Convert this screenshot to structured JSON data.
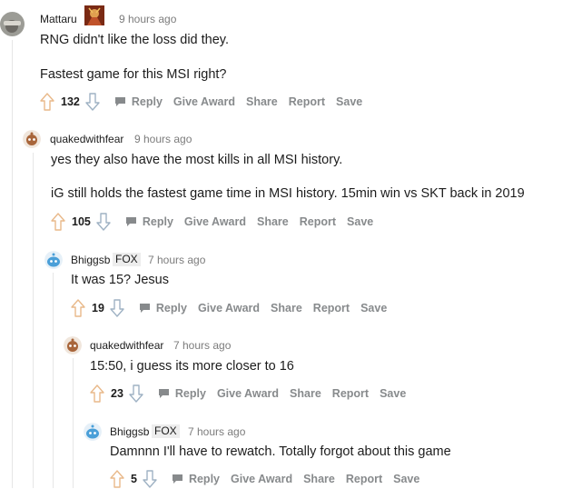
{
  "comments": [
    {
      "user": "Mattaru",
      "time": "9 hours ago",
      "lines": [
        "RNG didn't like the loss did they.",
        "Fastest game for this MSI right?"
      ],
      "votes": "132"
    },
    {
      "user": "quakedwithfear",
      "time": "9 hours ago",
      "lines": [
        "yes they also have the most kills in all MSI history.",
        "iG still holds the fastest game time in MSI history. 15min win vs SKT back in 2019"
      ],
      "votes": "105"
    },
    {
      "user": "Bhiggsb",
      "flair": "FOX",
      "time": "7 hours ago",
      "lines": [
        "It was 15? Jesus"
      ],
      "votes": "19"
    },
    {
      "user": "quakedwithfear",
      "time": "7 hours ago",
      "lines": [
        "15:50, i guess its more closer to 16"
      ],
      "votes": "23"
    },
    {
      "user": "Bhiggsb",
      "flair": "FOX",
      "time": "7 hours ago",
      "lines": [
        "Damnnn I'll have to rewatch. Totally forgot about this game"
      ],
      "votes": "5"
    }
  ],
  "actions": {
    "reply": "Reply",
    "give_award": "Give Award",
    "share": "Share",
    "report": "Report",
    "save": "Save"
  },
  "colors": {
    "upvote": "#e9b98a",
    "downvote": "#9fb2c4",
    "muted": "#878a8c",
    "thread_line": "#e6e6e6"
  },
  "icons": {
    "upvote": "upvote-arrow-icon",
    "downvote": "downvote-arrow-icon",
    "reply": "chat-bubble-icon"
  }
}
